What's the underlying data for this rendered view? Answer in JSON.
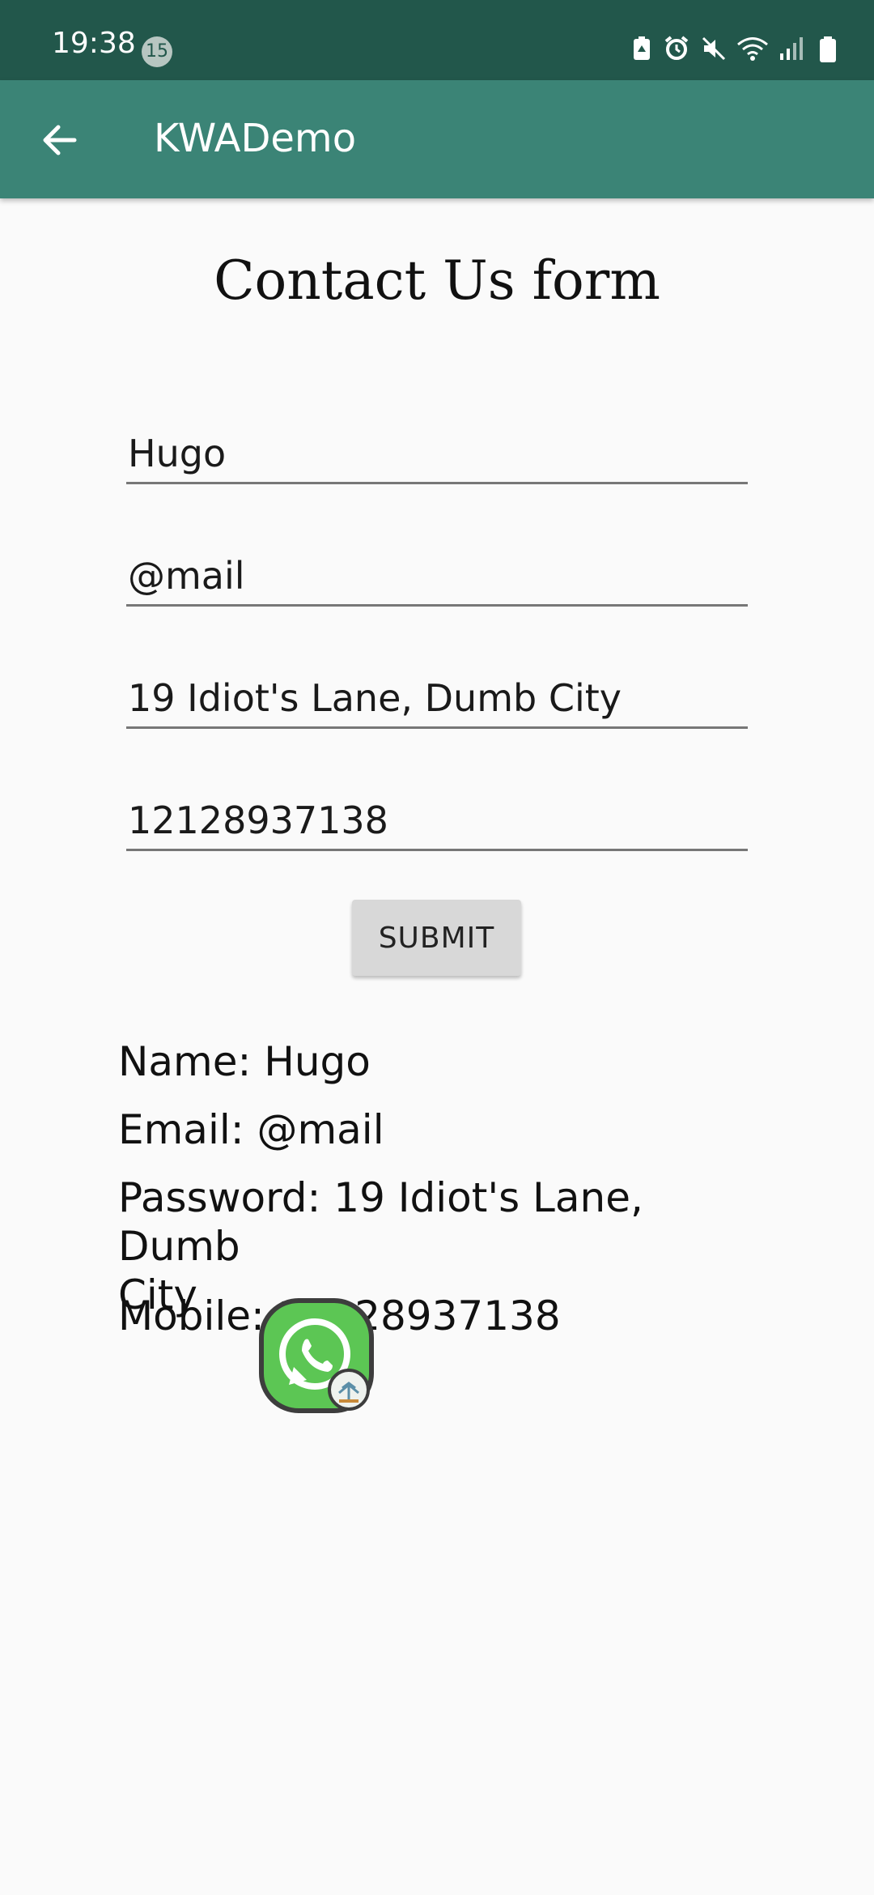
{
  "status_bar": {
    "time": "19:38",
    "notification_count": "15",
    "icons": [
      "battery-saver-icon",
      "alarm-icon",
      "mute-icon",
      "wifi-icon",
      "signal-icon",
      "battery-icon"
    ]
  },
  "app_bar": {
    "title": "KWADemo",
    "back_icon": "arrow-left-icon",
    "background": "#3b8476"
  },
  "form": {
    "title": "Contact Us form",
    "fields": [
      {
        "name": "name",
        "value": "Hugo"
      },
      {
        "name": "email",
        "value": "@mail"
      },
      {
        "name": "password",
        "value": "19 Idiot's Lane, Dumb City"
      },
      {
        "name": "mobile",
        "value": "12128937138"
      }
    ],
    "submit_label": "SUBMIT"
  },
  "results": {
    "name": "Name: Hugo",
    "email": "Email: @mail",
    "password_line1": "Password: 19 Idiot's Lane, Dumb",
    "password_line2": "City",
    "mobile": "Mobile: 12128937138"
  },
  "overlay": {
    "icon": "whatsapp-chat-bubble-icon"
  },
  "colors": {
    "status_bar": "#22574b",
    "app_bar": "#3b8476",
    "background": "#fafafa",
    "whatsapp_green": "#5cc654"
  }
}
